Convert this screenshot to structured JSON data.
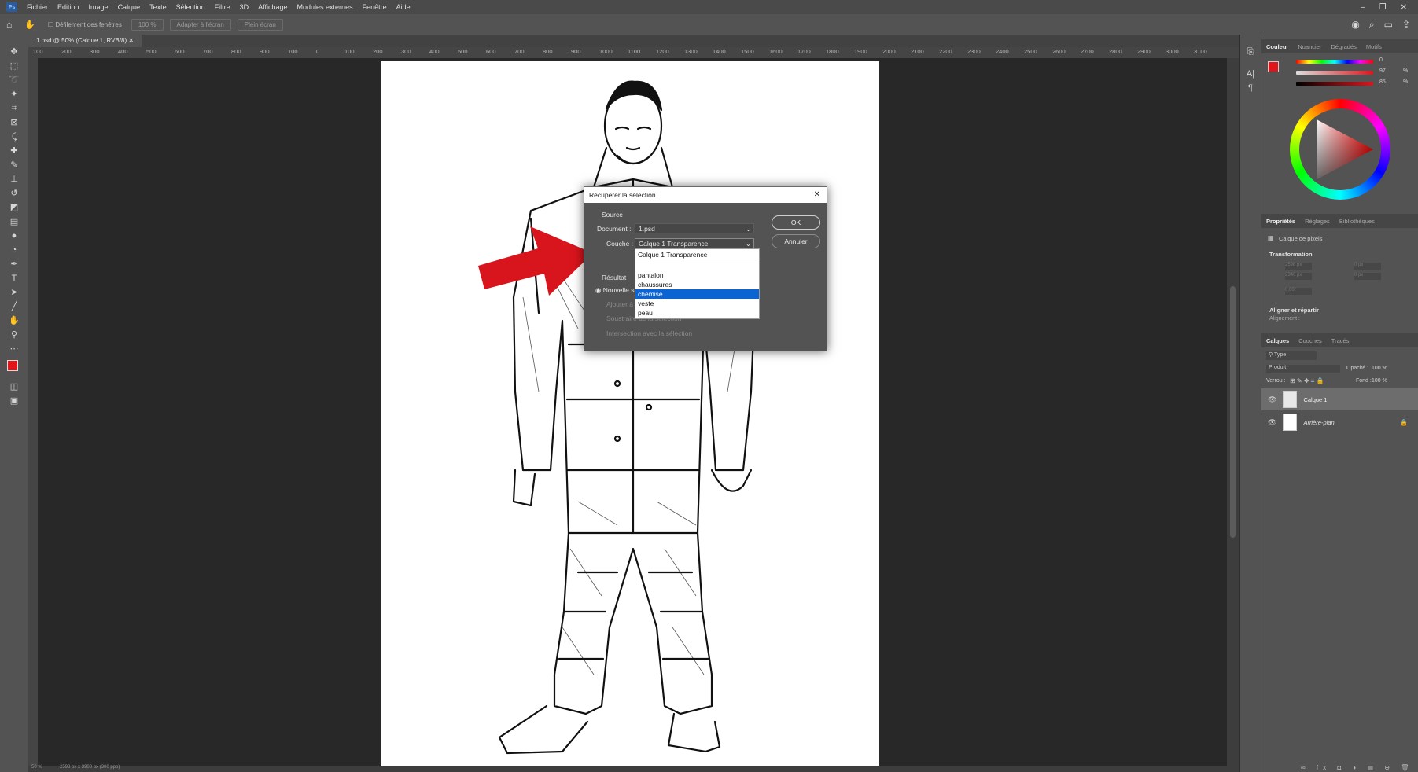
{
  "menu": {
    "app_logo": "Ps",
    "items": [
      "Fichier",
      "Edition",
      "Image",
      "Calque",
      "Texte",
      "Sélection",
      "Filtre",
      "3D",
      "Affichage",
      "Modules externes",
      "Fenêtre",
      "Aide"
    ]
  },
  "options_bar": {
    "scroll_all": "Défilement des fenêtres",
    "zoom_btn": "100 %",
    "fit_screen_btn": "Adapter à l'écran",
    "fill_screen_btn": "Plein écran"
  },
  "document": {
    "tab_label": "1.psd @ 50% (Calque 1, RVB/8)"
  },
  "ruler_labels": [
    "100",
    "200",
    "300",
    "400",
    "500",
    "600",
    "700",
    "800",
    "900",
    "100",
    "0",
    "100",
    "200",
    "300",
    "400",
    "500",
    "600",
    "700",
    "800",
    "900",
    "1000",
    "1100",
    "1200",
    "1300",
    "1400",
    "1500",
    "1600",
    "1700",
    "1800",
    "1900",
    "2000",
    "2100",
    "2200",
    "2300",
    "2400",
    "2500",
    "2600",
    "2700",
    "2800",
    "2900",
    "3000",
    "3100"
  ],
  "status_bar": {
    "zoom": "50 %",
    "doc_size": "2598 px x 3900 px (300 ppp)"
  },
  "right_panel": {
    "color_tabs": [
      "Couleur",
      "Nuancier",
      "Dégradés",
      "Motifs"
    ],
    "color_values": {
      "h": "0",
      "s": "97",
      "b": "85",
      "percent": "%"
    },
    "props_tabs": [
      "Propriétés",
      "Réglages",
      "Bibliothèques"
    ],
    "pixel_layer_label": "Calque de pixels",
    "transform_header": "Transformation",
    "transform_fields": {
      "w": "2598 px",
      "h": "2340 px",
      "x": "0 px",
      "y": "0 px",
      "angle": "0,00°"
    },
    "align_header": "Aligner et répartir",
    "align_label": "Alignement :",
    "layers_tabs": [
      "Calques",
      "Couches",
      "Tracés"
    ],
    "filter_type": "Type",
    "blend_mode": "Produit",
    "opacity_label": "Opacité :",
    "opacity_value": "100 %",
    "lock_label": "Verrou :",
    "fill_label": "Fond :",
    "fill_value": "100 %",
    "layers": [
      {
        "name": "Calque 1"
      },
      {
        "name": "Arrière-plan"
      }
    ]
  },
  "dialog": {
    "title": "Récupérer la sélection",
    "source_label": "Source",
    "document_label": "Document :",
    "document_value": "1.psd",
    "channel_label": "Couche :",
    "channel_value": "Calque 1 Transparence",
    "result_label": "Résultat",
    "new_selection": "Nouvelle sélection",
    "add_to": "Ajouter à la sélection",
    "subtract_from": "Soustraire de la sélection",
    "intersect_with": "Intersection avec la sélection",
    "ok": "OK",
    "cancel": "Annuler",
    "dropdown_options": [
      "Calque 1 Transparence",
      "pantalon",
      "chaussures",
      "chemise",
      "veste",
      "peau"
    ],
    "dropdown_selected": "chemise"
  },
  "colors": {
    "foreground": "#e0141b",
    "background": "#000000",
    "arrow": "#d8141c",
    "selection_blue": "#0b64d1"
  }
}
